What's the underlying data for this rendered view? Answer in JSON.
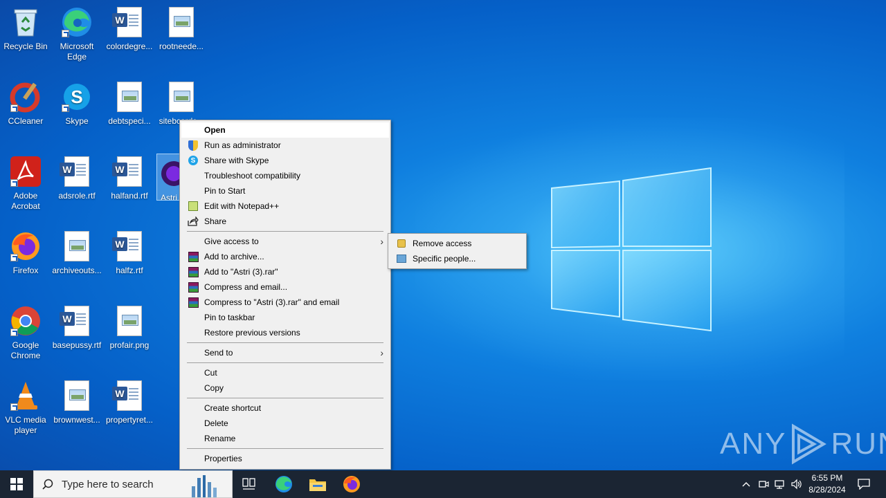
{
  "desktop": {
    "icons": [
      {
        "label": "Recycle Bin"
      },
      {
        "label": "Microsoft Edge"
      },
      {
        "label": "colordegre..."
      },
      {
        "label": "rootneede..."
      },
      {
        "label": "CCleaner"
      },
      {
        "label": "Skype"
      },
      {
        "label": "debtspeci..."
      },
      {
        "label": "sitebcards..."
      },
      {
        "label": "Adobe Acrobat"
      },
      {
        "label": "adsrole.rtf"
      },
      {
        "label": "halfand.rtf"
      },
      {
        "label": "Astri"
      },
      {
        "label": "Firefox"
      },
      {
        "label": "archiveouts..."
      },
      {
        "label": "halfz.rtf"
      },
      {
        "label": "Google Chrome"
      },
      {
        "label": "basepussy.rtf"
      },
      {
        "label": "profair.png"
      },
      {
        "label": "VLC media player"
      },
      {
        "label": "brownwest..."
      },
      {
        "label": "propertyret..."
      }
    ]
  },
  "context_menu": {
    "items": [
      {
        "label": "Open",
        "icon": ""
      },
      {
        "label": "Run as administrator",
        "icon": "shield-icon"
      },
      {
        "label": "Share with Skype",
        "icon": "skype-icon"
      },
      {
        "label": "Troubleshoot compatibility",
        "icon": ""
      },
      {
        "label": "Pin to Start",
        "icon": ""
      },
      {
        "label": "Edit with Notepad++",
        "icon": "notepadpp-icon"
      },
      {
        "label": "Share",
        "icon": "share-icon"
      },
      {
        "label": "Give access to",
        "icon": "",
        "submenu": true
      },
      {
        "label": "Add to archive...",
        "icon": "winrar-icon"
      },
      {
        "label": "Add to \"Astri (3).rar\"",
        "icon": "winrar-icon"
      },
      {
        "label": "Compress and email...",
        "icon": "winrar-icon"
      },
      {
        "label": "Compress to \"Astri (3).rar\" and email",
        "icon": "winrar-icon"
      },
      {
        "label": "Pin to taskbar",
        "icon": ""
      },
      {
        "label": "Restore previous versions",
        "icon": ""
      },
      {
        "label": "Send to",
        "icon": "",
        "submenu": true
      },
      {
        "label": "Cut",
        "icon": ""
      },
      {
        "label": "Copy",
        "icon": ""
      },
      {
        "label": "Create shortcut",
        "icon": ""
      },
      {
        "label": "Delete",
        "icon": ""
      },
      {
        "label": "Rename",
        "icon": ""
      },
      {
        "label": "Properties",
        "icon": ""
      }
    ]
  },
  "submenu": {
    "items": [
      {
        "label": "Remove access",
        "icon": "lock-icon"
      },
      {
        "label": "Specific people...",
        "icon": "people-icon"
      }
    ]
  },
  "taskbar": {
    "search_placeholder": "Type here to search",
    "time": "6:55 PM",
    "date": "8/28/2024"
  },
  "watermark": {
    "left": "ANY",
    "right": "RUN"
  },
  "colors": {
    "taskbar": "#1b2533",
    "menu_bg": "#f0f0f0",
    "desktop_accent": "#0f7fdf"
  }
}
